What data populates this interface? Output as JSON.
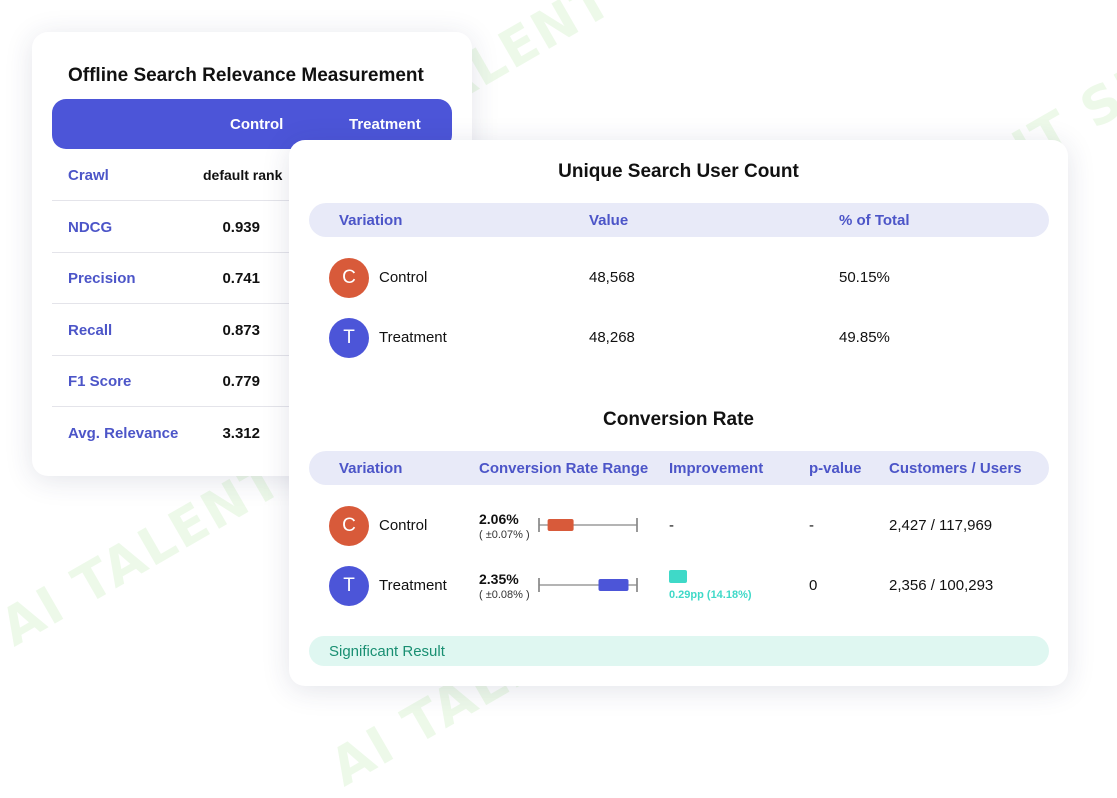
{
  "watermark_text": "AI TALENT SPACE",
  "offline_card": {
    "title": "Offline Search Relevance Measurement",
    "columns": [
      "Control",
      "Treatment"
    ],
    "rows": [
      {
        "name": "Crawl",
        "control": "default rank"
      },
      {
        "name": "NDCG",
        "control": "0.939"
      },
      {
        "name": "Precision",
        "control": "0.741"
      },
      {
        "name": "Recall",
        "control": "0.873"
      },
      {
        "name": "F1 Score",
        "control": "0.779"
      },
      {
        "name": "Avg. Relevance",
        "control": "3.312"
      }
    ]
  },
  "unique_users": {
    "title": "Unique Search User Count",
    "columns": [
      "Variation",
      "Value",
      "% of Total"
    ],
    "rows": [
      {
        "initial": "C",
        "name": "Control",
        "value": "48,568",
        "pct": "50.15%",
        "color": "#d85a3a"
      },
      {
        "initial": "T",
        "name": "Treatment",
        "value": "48,268",
        "pct": "49.85%",
        "color": "#4c55d8"
      }
    ]
  },
  "conversion": {
    "title": "Conversion Rate",
    "columns": [
      "Variation",
      "Conversion Rate Range",
      "Improvement",
      "p-value",
      "Customers / Users"
    ],
    "rows": [
      {
        "initial": "C",
        "name": "Control",
        "rate": "2.06%",
        "range": "( ±0.07% )",
        "bar_pos": 0.22,
        "bar_color": "#d85a3a",
        "improvement": "-",
        "pvalue": "-",
        "customers": "2,427 / 117,969",
        "color": "#d85a3a"
      },
      {
        "initial": "T",
        "name": "Treatment",
        "rate": "2.35%",
        "range": "( ±0.08% )",
        "bar_pos": 0.76,
        "bar_color": "#4c55d8",
        "improvement": "0.29pp (14.18%)",
        "pvalue": "0",
        "customers": "2,356 / 100,293",
        "color": "#4c55d8"
      }
    ]
  },
  "significance": {
    "label": "Significant Result"
  },
  "colors": {
    "primary": "#4c55d8",
    "control": "#d85a3a",
    "improvement": "#3fd9c8",
    "significant_bg": "#dff7f1"
  }
}
